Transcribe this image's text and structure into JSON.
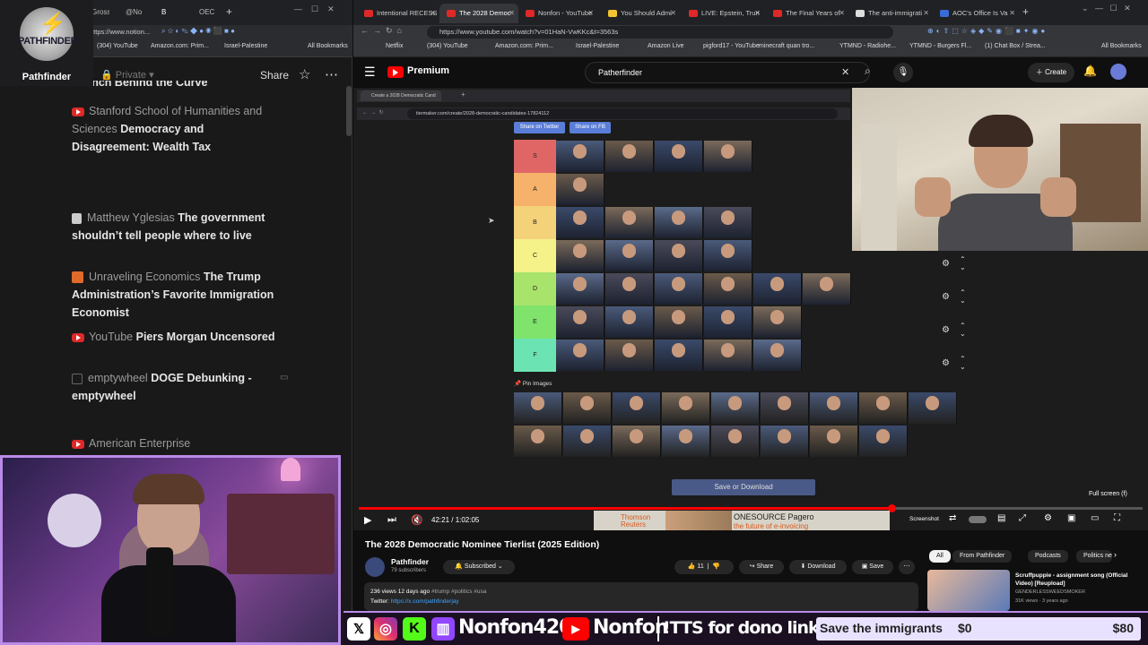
{
  "left_browser": {
    "tabs": [
      {
        "label": "Gross"
      },
      {
        "label": "@No"
      },
      {
        "label": "B"
      },
      {
        "label": "OEC"
      }
    ],
    "url": "https://www.notion...",
    "bookmarks": [
      "(304) YouTube",
      "Amazon.com: Prim...",
      "Israel-Palestine",
      "All Bookmarks"
    ],
    "logo_caption": "Pathfinder",
    "logo_text": "PATHFINDER",
    "notion_bar": {
      "privacy": "Private",
      "share": "Share"
    },
    "partial_heading": "Launch Behind the Curve",
    "items": [
      {
        "source": "Stanford School of Humanities and Sciences",
        "title": "Democracy and Disagreement: Wealth Tax",
        "icon": "youtube-icon"
      },
      {
        "source": "Matthew Yglesias",
        "title": "The government shouldn’t tell people where to live",
        "icon": "substack-icon"
      },
      {
        "source": "Unraveling Economics",
        "title": "The Trump Administration’s Favorite Immigration Economist",
        "icon": "substack-icon"
      },
      {
        "source": "YouTube",
        "title": "Piers Morgan Uncensored",
        "icon": "youtube-icon"
      },
      {
        "source": "emptywheel",
        "title": "DOGE Debunking - emptywheel",
        "icon": "web-icon"
      },
      {
        "source": "American Enterprise",
        "title": "",
        "icon": "youtube-icon"
      }
    ]
  },
  "right_browser": {
    "tabs": [
      {
        "label": "Intentional RECESS"
      },
      {
        "label": "The 2028 Democ"
      },
      {
        "label": "Nonfon - YouTube"
      },
      {
        "label": "You Should Admi"
      },
      {
        "label": "LIVE: Epstein, Trun"
      },
      {
        "label": "The Final Years of"
      },
      {
        "label": "The anti-immigrati"
      },
      {
        "label": "AOC's Office Is Va"
      }
    ],
    "url": "https://www.youtube.com/watch?v=01HaN-VwKKc&t=3563s",
    "bookmarks": [
      "Netflix",
      "(304) YouTube",
      "Amazon.com: Prim...",
      "Israel-Palestine",
      "Amazon Live",
      "pigford17 - YouTube",
      "minecraft quan tro...",
      "YTMND - Radiohe...",
      "YTMND - Burgers Fl...",
      "(1) Chat Box / Strea...",
      "All Bookmarks"
    ]
  },
  "youtube": {
    "brand": "Premium",
    "search_value": "Patherfinder",
    "create_label": "Create",
    "inner_browser": {
      "tab": "Create a 2028 Democratic Cand",
      "url": "tiermaker.com/create/2028-democratic-candidates-17824112",
      "share_twitter": "Share on Twitter",
      "share_fb": "Share on FB"
    },
    "tiers": [
      {
        "label": "S",
        "color": "#e06666",
        "count": 4
      },
      {
        "label": "A",
        "color": "#f6b26b",
        "count": 1
      },
      {
        "label": "B",
        "color": "#f4d27a",
        "count": 4
      },
      {
        "label": "C",
        "color": "#f5f28a",
        "count": 4
      },
      {
        "label": "D",
        "color": "#a8e36c",
        "count": 6
      },
      {
        "label": "E",
        "color": "#7fe36c",
        "count": 5
      },
      {
        "label": "F",
        "color": "#6ce3b2",
        "count": 5
      }
    ],
    "pin_images_label": "Pin Images",
    "pool_rows": [
      9,
      8
    ],
    "save_button": "Save or Download",
    "fullscreen_hint": "Full screen (f)",
    "time": "42:21 / 1:02:05",
    "progress": 0.68,
    "ad_brand": "Thomson Reuters",
    "ad_text": "ONESOURCE Pagero",
    "ad_sub": "the future of e-invoicing",
    "screenshot_label": "Screenshot",
    "video_title": "The 2028 Democratic Nominee Tierlist (2025 Edition)",
    "channel": {
      "name": "Pathfinder",
      "subs": "79 subscribers",
      "subscribed": "Subscribed"
    },
    "actions": {
      "likes": "11",
      "share": "Share",
      "download": "Download",
      "save": "Save"
    },
    "description": {
      "meta": "236 views  12 days ago",
      "tags": "#trump #politics #usa",
      "twitter_label": "Twitter:",
      "twitter_link": "https://x.com/pathfinderjay"
    },
    "chips": [
      "All",
      "From Pathfinder",
      "Podcasts",
      "Politics ne"
    ],
    "rec": {
      "title": "Scruffpuppie - assignment song (Official Video) [Reupload]",
      "channel": "GENDERLESSWEEDSMOKER",
      "meta": "31K views · 3 years ago"
    }
  },
  "overlay": {
    "handle1": "Nonfon420",
    "handle2": "Nonfon",
    "tts": "!TTS for dono link",
    "goal_label": "Save the immigrants",
    "goal_current": "$0",
    "goal_target": "$80"
  }
}
